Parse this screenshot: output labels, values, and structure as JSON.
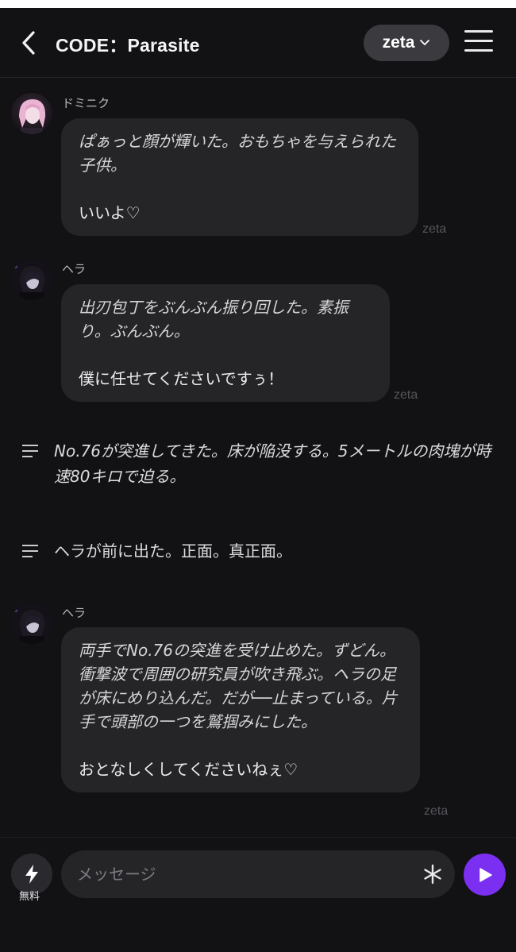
{
  "header": {
    "title": "CODE：Parasite",
    "model_label": "zeta"
  },
  "messages": [
    {
      "type": "character",
      "sender": "ドミニク",
      "action": "ぱぁっと顔が輝いた。おもちゃを与えられた子供。",
      "speech": "いいよ♡",
      "watermark": "zeta"
    },
    {
      "type": "character",
      "sender": "ヘラ",
      "action": "出刃包丁をぶんぶん振り回した。素振り。ぶんぶん。",
      "speech": "僕に任せてくださいですぅ！",
      "watermark": "zeta"
    },
    {
      "type": "narration",
      "text": "No.76が突進してきた。床が陥没する。5メートルの肉塊が時速80キロで迫る。"
    },
    {
      "type": "narration",
      "text": "ヘラが前に出た。正面。真正面。"
    },
    {
      "type": "character",
      "sender": "ヘラ",
      "action": "両手でNo.76の突進を受け止めた。ずどん。衝撃波で周囲の研究員が吹き飛ぶ。ヘラの足が床にめり込んだ。だが──止まっている。片手で頭部の一つを鷲掴みにした。",
      "speech": "おとなしくしてくださいねぇ♡",
      "watermark": "zeta"
    }
  ],
  "input": {
    "boost_label": "無料",
    "placeholder": "メッセージ"
  },
  "colors": {
    "background": "#121214",
    "bubble": "#252528",
    "accent": "#7b2ff0"
  },
  "icons": [
    "back-arrow-icon",
    "chevron-down-icon",
    "hamburger-menu-icon",
    "narration-icon",
    "bolt-icon",
    "asterisk-icon",
    "send-icon"
  ]
}
